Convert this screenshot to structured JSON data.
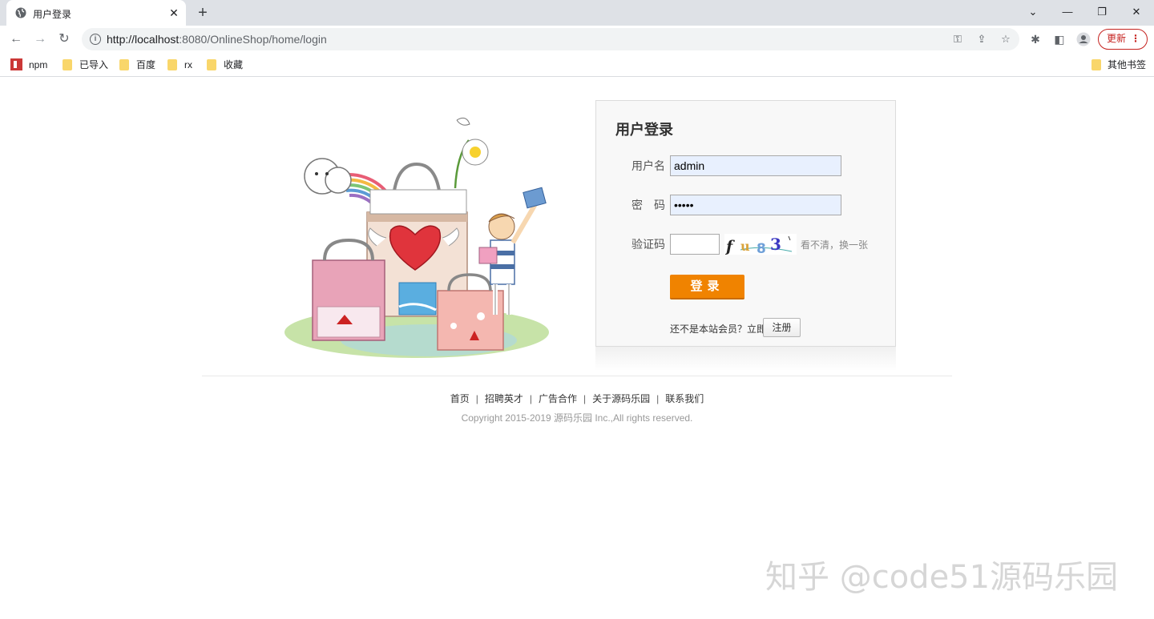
{
  "browser": {
    "tab": {
      "title": "用户登录",
      "close_glyph": "✕",
      "favicon": "globe-icon"
    },
    "new_tab_glyph": "+",
    "window_controls": {
      "dropdown": "⌄",
      "minimize": "—",
      "restore": "❐",
      "close": "✕"
    },
    "nav": {
      "back": "←",
      "forward": "→",
      "reload": "↻"
    },
    "address": {
      "host": "http://localhost",
      "rest": ":8080/OnlineShop/home/login"
    },
    "toolbar_icons": [
      "key-icon",
      "share-icon",
      "star-icon",
      "extensions-icon",
      "sidepanel-icon",
      "profile-icon"
    ],
    "update_label": "更新",
    "bookmarks": [
      "npm",
      "已导入",
      "百度",
      "rx",
      "收藏"
    ],
    "other_bookmarks": "其他书签"
  },
  "login": {
    "title": "用户登录",
    "username_label": "用户名",
    "username_value": "admin",
    "password_label": "密　码",
    "password_value": "•••••",
    "captcha_label": "验证码",
    "captcha_value": "",
    "captcha_chars": [
      "f",
      "u",
      "8",
      "3"
    ],
    "captcha_refresh": "看不清，换一张",
    "submit_label": "登录",
    "register_prompt": "还不是本站会员？立即",
    "register_label": "注册"
  },
  "footer": {
    "links": [
      "首页",
      "招聘英才",
      "广告合作",
      "关于源码乐园",
      "联系我们"
    ],
    "separator": "|",
    "copyright": "Copyright 2015-2019 源码乐园 Inc.,All rights reserved."
  },
  "watermark": "知乎 @code51源码乐园",
  "colors": {
    "accent": "#f08300",
    "input_bg": "#e8f0fe",
    "update": "#c5221f"
  }
}
